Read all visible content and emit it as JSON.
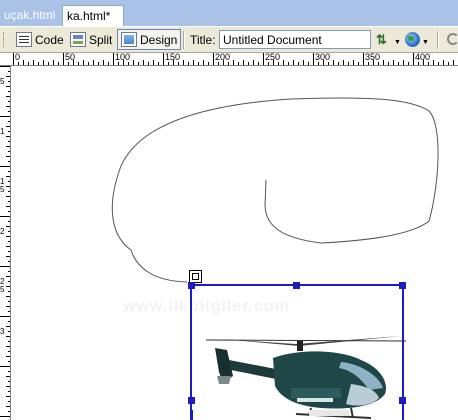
{
  "tabs": [
    {
      "label": "uçak.html",
      "active": false
    },
    {
      "label": "ka.html*",
      "active": true
    }
  ],
  "toolbar": {
    "code_label": "Code",
    "split_label": "Split",
    "design_label": "Design",
    "title_label": "Title:",
    "title_value": "Untitled Document"
  },
  "ruler": {
    "h_labels": [
      "0",
      "50",
      "100",
      "150",
      "200",
      "250",
      "300",
      "350",
      "400"
    ],
    "v_labels": [
      "5",
      "1",
      "1\n5",
      "2",
      "2\n5",
      "3"
    ]
  },
  "canvas": {
    "watermark": "www.ilkbilgiler.com",
    "selection_color": "#1c1cc0"
  },
  "colors": {
    "tabbar": "#a9c2e6",
    "toolbar": "#ece9d8"
  }
}
